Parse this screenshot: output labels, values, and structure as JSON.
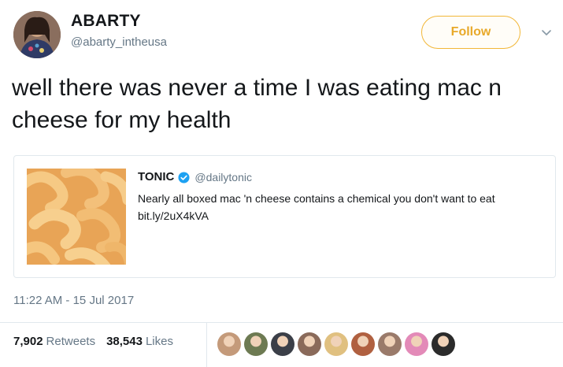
{
  "tweet": {
    "author": {
      "display_name": "ABARTY",
      "handle": "@abarty_intheusa",
      "avatar": "user-avatar"
    },
    "follow_label": "Follow",
    "text": "well there was never a time I was eating mac n cheese for my health",
    "quoted": {
      "author_name": "TONIC",
      "verified": true,
      "handle": "@dailytonic",
      "text": "Nearly all boxed mac 'n cheese contains a chemical you don't want to eat bit.ly/2uX4kVA",
      "image": "mac-and-cheese-photo"
    },
    "timestamp": "11:22 AM - 15 Jul 2017",
    "stats": {
      "retweets_count": "7,902",
      "retweets_label": "Retweets",
      "likes_count": "38,543",
      "likes_label": "Likes"
    },
    "liker_avatars": [
      "#c49a7a",
      "#6d7a52",
      "#3b3f48",
      "#8a6a5a",
      "#e0c080",
      "#b06040",
      "#9a7a6a",
      "#e38ab8",
      "#2b2b2b"
    ]
  },
  "colors": {
    "follow_border": "#f2b738",
    "follow_text": "#e8a92a",
    "secondary_text": "#657786",
    "verified_blue": "#1da1f2"
  }
}
